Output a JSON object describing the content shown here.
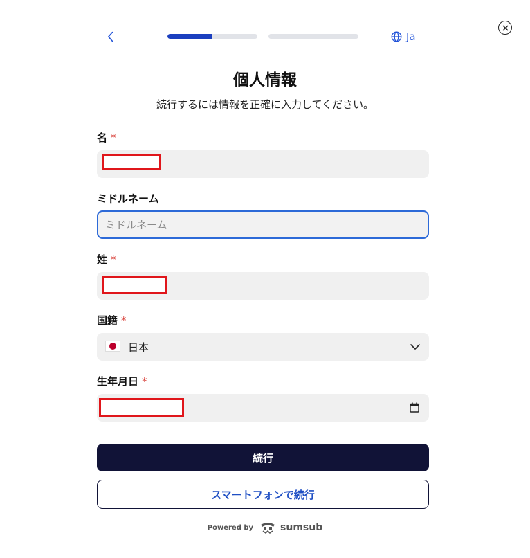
{
  "header": {
    "back_icon": "chevron-left-icon",
    "progress": [
      0.5,
      0.0
    ],
    "language": "Ja",
    "close_icon": "close-circle-icon"
  },
  "page": {
    "title": "個人情報",
    "subtitle": "続行するには情報を正確に入力してください。"
  },
  "form": {
    "required_mark": "*",
    "first_name": {
      "label": "名",
      "value": ""
    },
    "middle_name": {
      "label": "ミドルネーム",
      "placeholder": "ミドルネーム",
      "value": ""
    },
    "last_name": {
      "label": "姓",
      "value": ""
    },
    "nationality": {
      "label": "国籍",
      "value": "日本",
      "flag": "japan-flag-icon"
    },
    "birth_date": {
      "label": "生年月日",
      "value": ""
    }
  },
  "buttons": {
    "continue": "続行",
    "continue_on_phone": "スマートフォンで続行"
  },
  "footer": {
    "powered_by": "Powered by",
    "brand": "sumsub"
  },
  "colors": {
    "accent": "#2253d8",
    "primary_button": "#111337",
    "required": "#d9433c",
    "redaction": "#e0161b"
  }
}
